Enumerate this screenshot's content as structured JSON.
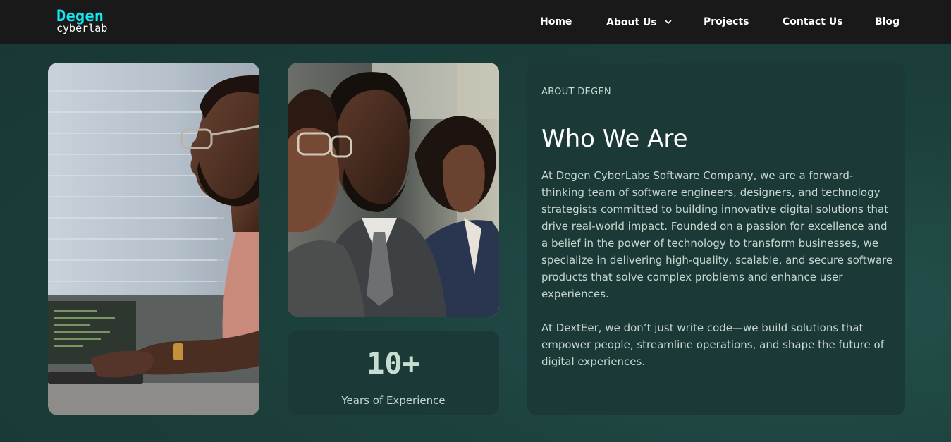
{
  "brand": {
    "name_top": "Degen",
    "name_bottom": "cyberlab",
    "accent_color": "#13e6f0"
  },
  "nav": {
    "items": [
      {
        "label": "Home"
      },
      {
        "label": "About Us",
        "has_dropdown": true,
        "icon": "chevron-down-icon"
      },
      {
        "label": "Projects"
      },
      {
        "label": "Contact Us"
      },
      {
        "label": "Blog"
      }
    ]
  },
  "images": {
    "photo_1": {
      "icon": "photo-man-at-laptop"
    },
    "photo_2": {
      "icon": "photo-people-seated"
    }
  },
  "stat": {
    "value": "10+",
    "label": "Years of Experience"
  },
  "about": {
    "eyebrow": "ABOUT DEGEN",
    "heading": "Who We Are",
    "paragraph_1": "At Degen CyberLabs Software Company, we are a forward-thinking team of software engineers, designers, and technology strategists committed to building innovative digital solutions that drive real-world impact. Founded on a passion for excellence and a belief in the power of technology to transform businesses, we specialize in delivering high-quality, scalable, and secure software products that solve complex problems and enhance user experiences.",
    "paragraph_2": "At DextEer, we don’t just write code—we build solutions that empower people, streamline operations, and shape the future of digital experiences."
  },
  "colors": {
    "navbar_bg": "#191919",
    "page_bg": "#1c403c",
    "card_bg": "#1a3937"
  }
}
